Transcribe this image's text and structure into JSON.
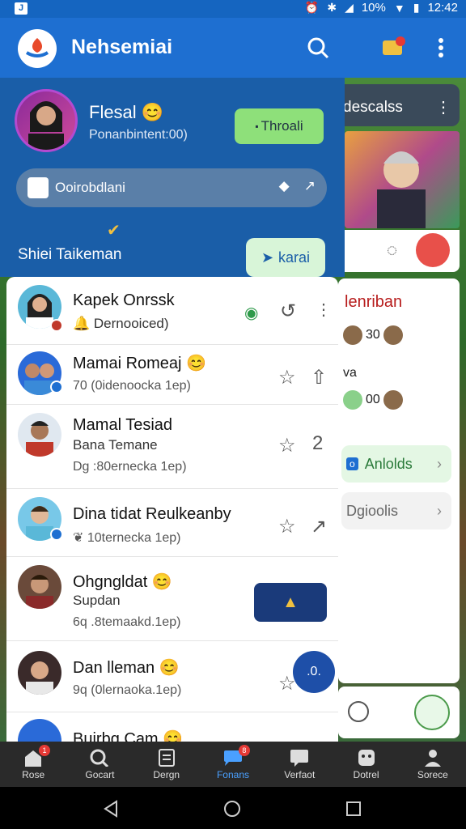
{
  "status_bar": {
    "left_badge": "J",
    "battery": "10%",
    "time": "12:42"
  },
  "app_bar": {
    "title": "Nehsemiai"
  },
  "profile": {
    "name": "Flesal",
    "subtitle": "Ponanbintent:00)",
    "action_button": "Throali",
    "search_text": "Ooirobdlani",
    "tag_text": "Shiei  Taikeman",
    "karai_button": "karai"
  },
  "side_panel": {
    "header": "descalss",
    "list_title": "lenriban",
    "row1_value": "30",
    "row2_label": "va",
    "row3_value": "00",
    "button_green": "Anlolds",
    "button_gray": "Dgioolis"
  },
  "chats": [
    {
      "name": "Kapek Onrssk",
      "line2": "Dernooiced)",
      "line3": ""
    },
    {
      "name": "Mamai Romeaj",
      "line2": "70 (0idenoocka 1ep)",
      "line3": ""
    },
    {
      "name": "Mamal Tesiad",
      "line2": "Bana Temane",
      "line3": "Dg :80ernecka 1ep)"
    },
    {
      "name": "Dina tidat Reulkeanby",
      "line2": "10ternecka 1ep)",
      "line3": ""
    },
    {
      "name": "Ohgngldat",
      "line2": "Supdan",
      "line3": "6q .8temaakd.1ep)"
    },
    {
      "name": "Dan lleman",
      "line2": "9q (0lernaoka.1ep)",
      "line3": ""
    },
    {
      "name": "Buirbg Cam",
      "line2": "",
      "line3": ""
    }
  ],
  "chat_counts": {
    "row3": "2"
  },
  "fab_label": ".0.",
  "bottom_nav": [
    {
      "label": "Rose",
      "badge": "1"
    },
    {
      "label": "Gocart",
      "badge": ""
    },
    {
      "label": "Dergn",
      "badge": ""
    },
    {
      "label": "Fonans",
      "badge": "8"
    },
    {
      "label": "Verfaot",
      "badge": ""
    },
    {
      "label": "Dotrel",
      "badge": ""
    },
    {
      "label": "Sorece",
      "badge": ""
    }
  ]
}
